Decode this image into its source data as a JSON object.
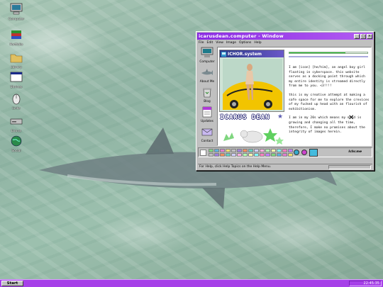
{
  "desktop": {
    "icons": [
      {
        "label": "Computer",
        "icon": "computer-icon"
      },
      {
        "label": "Portfolio",
        "icon": "books-icon"
      },
      {
        "label": "Library",
        "icon": "folder-icon"
      },
      {
        "label": "Shrines",
        "icon": "window-icon"
      },
      {
        "label": "Links",
        "icon": "mouse-icon"
      },
      {
        "label": "Extras",
        "icon": "drive-icon"
      },
      {
        "label": "Social",
        "icon": "globe-icon"
      }
    ]
  },
  "window": {
    "title": "icarusdean.computer - Window",
    "menu": [
      "File",
      "Edit",
      "View",
      "Image",
      "Options",
      "Help"
    ],
    "sidebar": [
      {
        "label": "Computer",
        "icon": "monitor-icon"
      },
      {
        "label": "About Me",
        "icon": "shark-icon"
      },
      {
        "label": "Blog",
        "icon": "recycle-bin-icon"
      },
      {
        "label": "Updates",
        "icon": "document-icon"
      },
      {
        "label": "Contact",
        "icon": "envelope-icon"
      }
    ],
    "pane_title": "ICHOR.system",
    "name": "ICARUS DEAN",
    "bio": [
      "I am [icon] [he/him], an angel boy girl floating in cyberspace. this website serves as a docking point through which my entire identity is streamed directly from me to you. <3!!!!",
      "this is my creative attempt at making a safe space for me to explore the crevices of my fucked up head with an flourish of exhibitionism.",
      "I am in my 20s which means my mind is growing and changing all the time, therefore, I make no promises about the integrity of images herein."
    ],
    "progress": 0.72,
    "palette_note": "Ichr.me",
    "status": "For Help, click Help Topics on the Help Menu.",
    "colors": {
      "title_start": "#8a2be2",
      "title_end": "#b25cf2",
      "accent": "#33c33a"
    }
  },
  "taskbar": {
    "start_label": "Start",
    "clock": "22:45:35"
  }
}
